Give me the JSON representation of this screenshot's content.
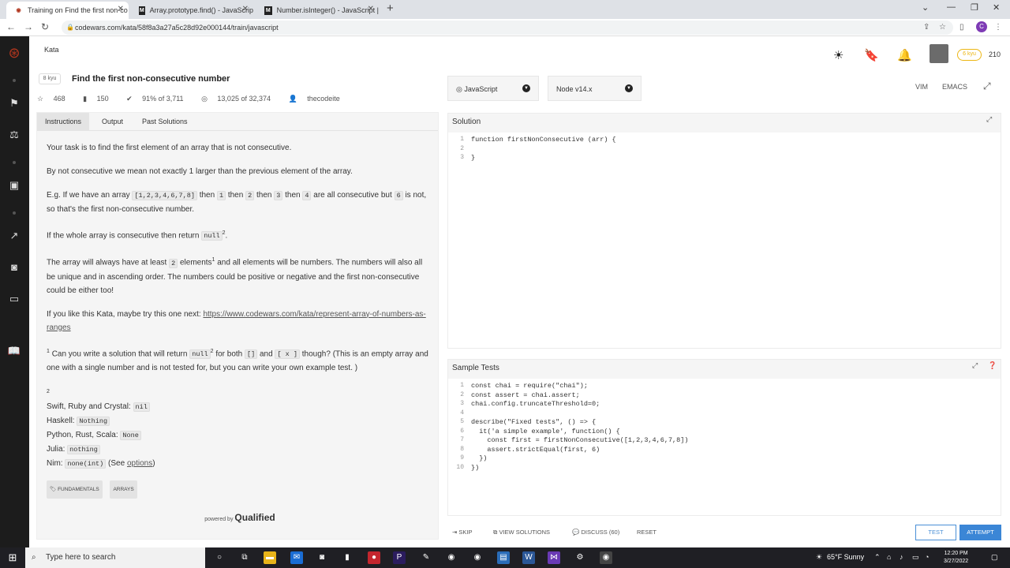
{
  "browser": {
    "tabs": [
      {
        "title": "Training on Find the first non-co",
        "icon": "codewars-icon"
      },
      {
        "title": "Array.prototype.find() - JavaScrip",
        "icon": "mdn-icon"
      },
      {
        "title": "Number.isInteger() - JavaScript |",
        "icon": "mdn-icon"
      }
    ],
    "url": "codewars.com/kata/58f8a3a27a5c28d92e000144/train/javascript",
    "profile_initial": "C"
  },
  "header": {
    "breadcrumb": "Kata",
    "rank": "6 kyu",
    "honor": "210"
  },
  "kata": {
    "kyu": "8 kyu",
    "title": "Find the first non-consecutive number",
    "stars": "468",
    "bookmarks": "150",
    "satisfaction": "91% of 3,711",
    "completions": "13,025 of 32,374",
    "author": "thecodeite"
  },
  "panel": {
    "tabs": [
      "Instructions",
      "Output",
      "Past Solutions"
    ],
    "p1": "Your task is to find the first element of an array that is not consecutive.",
    "p2": "By not consecutive we mean not exactly 1 larger than the previous element of the array.",
    "p3a": "E.g. If we have an array",
    "p3code": "[1,2,3,4,6,7,8]",
    "p3b": "then",
    "c1": "1",
    "c2": "2",
    "c3": "3",
    "c4": "4",
    "p3c": "are all consecutive but",
    "c6": "6",
    "p3d": "is not, so that's the first non-consecutive number.",
    "p4a": "If the whole array is consecutive then return",
    "null": "null",
    "p5a": "The array will always have at least",
    "p5b": "elements",
    "p5c": "and all elements will be numbers. The numbers will also all be unique and in ascending order. The numbers could be positive or negative and the first non-consecutive could be either too!",
    "p6a": "If you like this Kata, maybe try this one next:",
    "p6link": "https://www.codewars.com/kata/represent-array-of-numbers-as-ranges",
    "p7a": "Can you write a solution that will return",
    "p7b": "for both",
    "p7c1": "[]",
    "and": "and",
    "p7c2": "[ x ]",
    "p7d": "though? (This is an empty array and one with a single number and is not tested for, but you can write your own example test. )",
    "note_mark": "2",
    "note1_label": "Swift, Ruby and Crystal:",
    "note1_val": "nil",
    "note2_label": "Haskell:",
    "note2_val": "Nothing",
    "note3_label": "Python, Rust, Scala:",
    "note3_val": "None",
    "note4_label": "Julia:",
    "note4_val": "nothing",
    "note5_label": "Nim:",
    "note5_val": "none(int)",
    "note5_tail": "(See",
    "options": "options",
    "tags": [
      "FUNDAMENTALS",
      "ARRAYS"
    ],
    "powered_by": "powered by",
    "powered_brand": "Qualified"
  },
  "right": {
    "language": "JavaScript",
    "runtime": "Node v14.x",
    "vim": "VIM",
    "emacs": "EMACS",
    "solution_title": "Solution",
    "sample_title": "Sample Tests"
  },
  "solution_code": [
    "function firstNonConsecutive (arr) {",
    "",
    "}"
  ],
  "test_code": [
    "const chai = require(\"chai\");",
    "const assert = chai.assert;",
    "chai.config.truncateThreshold=0;",
    "",
    "describe(\"Fixed tests\", () => {",
    "  it('a simple example', function() {",
    "    const first = firstNonConsecutive([1,2,3,4,6,7,8])",
    "    assert.strictEqual(first, 6)",
    "  })",
    "})"
  ],
  "actions": {
    "skip": "SKIP",
    "view_solutions": "VIEW SOLUTIONS",
    "discuss": "DISCUSS (60)",
    "reset": "RESET",
    "test": "TEST",
    "attempt": "ATTEMPT"
  },
  "taskbar": {
    "search_placeholder": "Type here to search",
    "weather": "65°F  Sunny",
    "time": "12:20 PM",
    "date": "3/27/2022"
  }
}
